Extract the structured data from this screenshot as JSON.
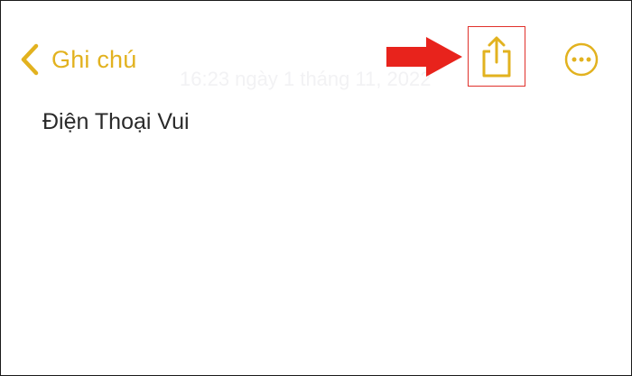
{
  "nav": {
    "back_label": "Ghi chú",
    "back_icon": "chevron-left-icon",
    "share_icon": "share-icon",
    "more_icon": "more-options-icon"
  },
  "note": {
    "timestamp": "16:23 ngày 1 tháng 11, 2022",
    "title": "Điện Thoại Vui"
  },
  "annotation": {
    "arrow_icon": "arrow-right-icon",
    "arrow_color": "#e8231c",
    "highlight_color": "#e0312b"
  },
  "colors": {
    "accent": "#e2b21f",
    "text": "#2a2a2a",
    "background": "#ffffff"
  }
}
